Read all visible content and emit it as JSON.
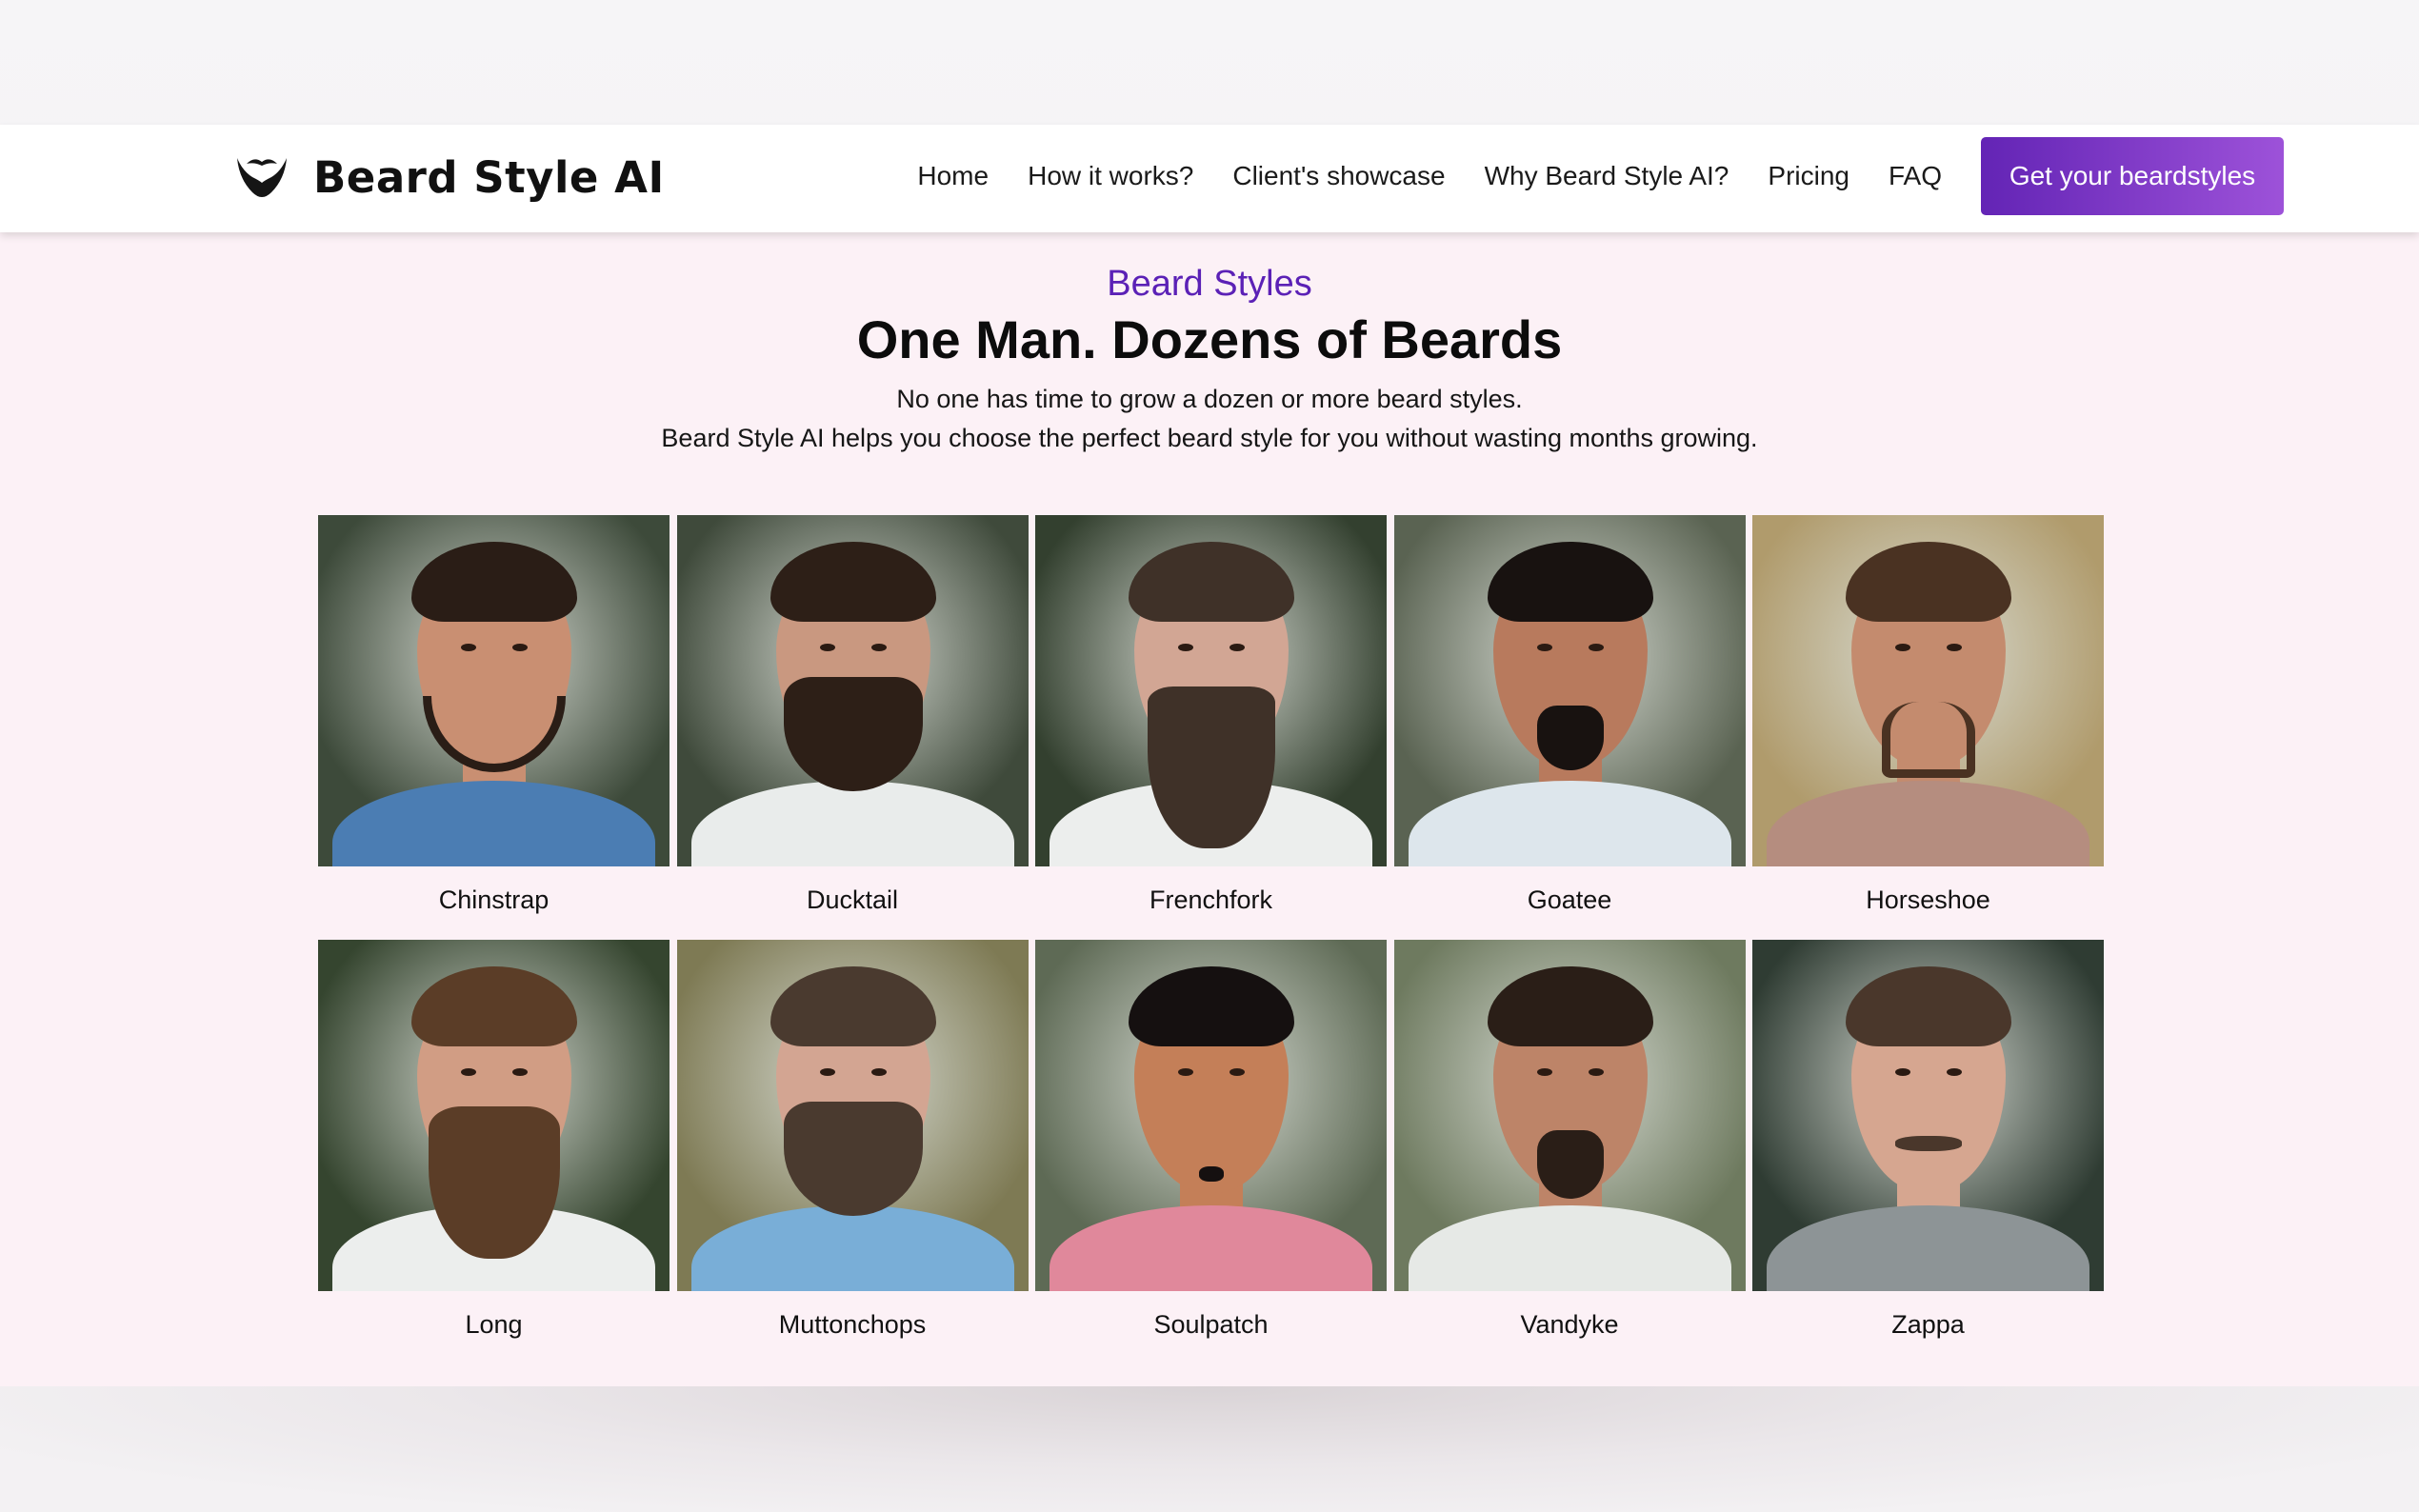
{
  "brand": {
    "name": "Beard Style AI",
    "logo_icon": "beard-icon"
  },
  "nav": {
    "links": [
      "Home",
      "How it works?",
      "Client's showcase",
      "Why Beard Style AI?",
      "Pricing",
      "FAQ"
    ],
    "cta": "Get your beardstyles"
  },
  "hero": {
    "eyebrow": "Beard Styles",
    "title": "One Man. Dozens of Beards",
    "line1": "No one has time to grow a dozen or more beard styles.",
    "line2": "Beard Style AI helps you choose the perfect beard style for you without wasting months growing."
  },
  "styles": [
    {
      "name": "Chinstrap",
      "shirt": "#4b7db3",
      "skin": "#c98f72",
      "hair": "#2a1d16",
      "bg": "#3d4a3a",
      "beard": "chinstrap"
    },
    {
      "name": "Ducktail",
      "shirt": "#e9eceb",
      "skin": "#c99880",
      "hair": "#2d1f17",
      "bg": "#3f4a3b",
      "beard": "full"
    },
    {
      "name": "Frenchfork",
      "shirt": "#eceeed",
      "skin": "#d2a694",
      "hair": "#3f3128",
      "bg": "#33402f",
      "beard": "fork"
    },
    {
      "name": "Goatee",
      "shirt": "#dde6ec",
      "skin": "#b87a5d",
      "hair": "#181210",
      "bg": "#5a6352",
      "beard": "goatee"
    },
    {
      "name": "Horseshoe",
      "shirt": "#b58d7f",
      "skin": "#c48b6e",
      "hair": "#4a3222",
      "bg": "#b09b6c",
      "beard": "horseshoe"
    },
    {
      "name": "Long",
      "shirt": "#eceeed",
      "skin": "#d19d84",
      "hair": "#5b3d27",
      "bg": "#35452f",
      "beard": "long"
    },
    {
      "name": "Muttonchops",
      "shirt": "#79aed7",
      "skin": "#d3a592",
      "hair": "#4a3a2f",
      "bg": "#7e7a54",
      "beard": "full"
    },
    {
      "name": "Soulpatch",
      "shirt": "#e0889b",
      "skin": "#c47f58",
      "hair": "#151010",
      "bg": "#5e6a55",
      "beard": "soul"
    },
    {
      "name": "Vandyke",
      "shirt": "#e6e9e6",
      "skin": "#bd8468",
      "hair": "#2a1e17",
      "bg": "#6e7a5f",
      "beard": "vandyke"
    },
    {
      "name": "Zappa",
      "shirt": "#8d9496",
      "skin": "#d6a690",
      "hair": "#4a372b",
      "bg": "#2f3c33",
      "beard": "zappa"
    }
  ]
}
